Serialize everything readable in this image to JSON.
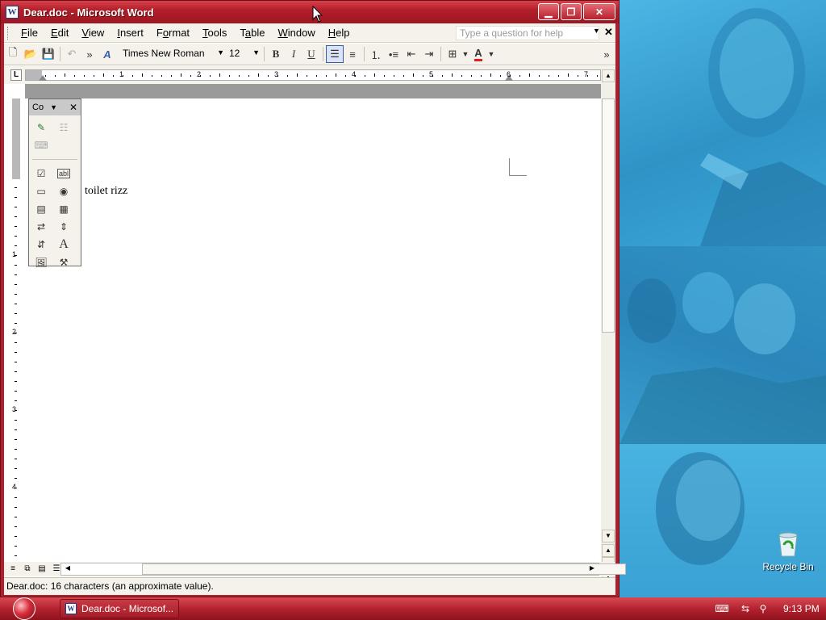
{
  "window": {
    "title": "Dear.doc - Microsoft Word",
    "app_icon": "W"
  },
  "menu": {
    "items": [
      {
        "pre": "",
        "ul": "F",
        "post": "ile"
      },
      {
        "pre": "",
        "ul": "E",
        "post": "dit"
      },
      {
        "pre": "",
        "ul": "V",
        "post": "iew"
      },
      {
        "pre": "",
        "ul": "I",
        "post": "nsert"
      },
      {
        "pre": "F",
        "ul": "o",
        "post": "rmat"
      },
      {
        "pre": "",
        "ul": "T",
        "post": "ools"
      },
      {
        "pre": "T",
        "ul": "a",
        "post": "ble"
      },
      {
        "pre": "",
        "ul": "W",
        "post": "indow"
      },
      {
        "pre": "",
        "ul": "H",
        "post": "elp"
      }
    ],
    "ask_placeholder": "Type a question for help"
  },
  "toolbar": {
    "font_name": "Times New Roman",
    "font_size": "12",
    "bold": "B",
    "italic": "I",
    "underline": "U",
    "font_color": "#e02020"
  },
  "ruler": {
    "numbers": [
      "1",
      "2",
      "3",
      "4",
      "5",
      "6",
      "7"
    ],
    "vertical_numbers": [
      "1",
      "2",
      "3",
      "4"
    ]
  },
  "document": {
    "text": "toilet rizz"
  },
  "control_toolbox": {
    "title": "Co"
  },
  "status": {
    "text": "Dear.doc: 16 characters (an approximate value)."
  },
  "desktop": {
    "recycle_bin_label": "Recycle Bin"
  },
  "taskbar": {
    "task_label": "Dear.doc - Microsof...",
    "clock": "9:13 PM"
  },
  "colors": {
    "title_red": "#b31f2a",
    "desktop_blue": "#3aa2d4"
  }
}
